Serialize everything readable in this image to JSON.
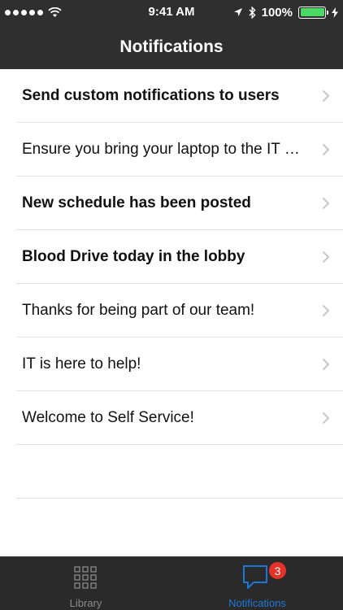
{
  "status_bar": {
    "time": "9:41 AM",
    "battery": "100%",
    "battery_level": 1.0,
    "signal_dots": 5,
    "icons": [
      "signal-dots-icon",
      "wifi-icon",
      "location-arrow-icon",
      "bluetooth-icon",
      "battery-icon",
      "charging-bolt-icon"
    ]
  },
  "nav": {
    "title": "Notifications"
  },
  "notifications": [
    {
      "label": "Send custom notifications to users",
      "unread": true
    },
    {
      "label": "Ensure you bring your laptop to the IT help desk",
      "unread": false
    },
    {
      "label": "New schedule has been posted",
      "unread": true
    },
    {
      "label": "Blood Drive today in the lobby",
      "unread": true
    },
    {
      "label": "Thanks for being part of our team!",
      "unread": false
    },
    {
      "label": "IT is here to help!",
      "unread": false
    },
    {
      "label": "Welcome to Self Service!",
      "unread": false
    }
  ],
  "tab_bar": {
    "library": {
      "label": "Library",
      "icon": "grid-icon"
    },
    "notifications": {
      "label": "Notifications",
      "icon": "chat-bubble-icon",
      "badge": "3"
    }
  },
  "colors": {
    "bar_background": "#2f2f2f",
    "tab_active": "#1e76d6",
    "tab_inactive": "#8a8a8a",
    "badge": "#e5332a",
    "battery": "#4cd964"
  }
}
